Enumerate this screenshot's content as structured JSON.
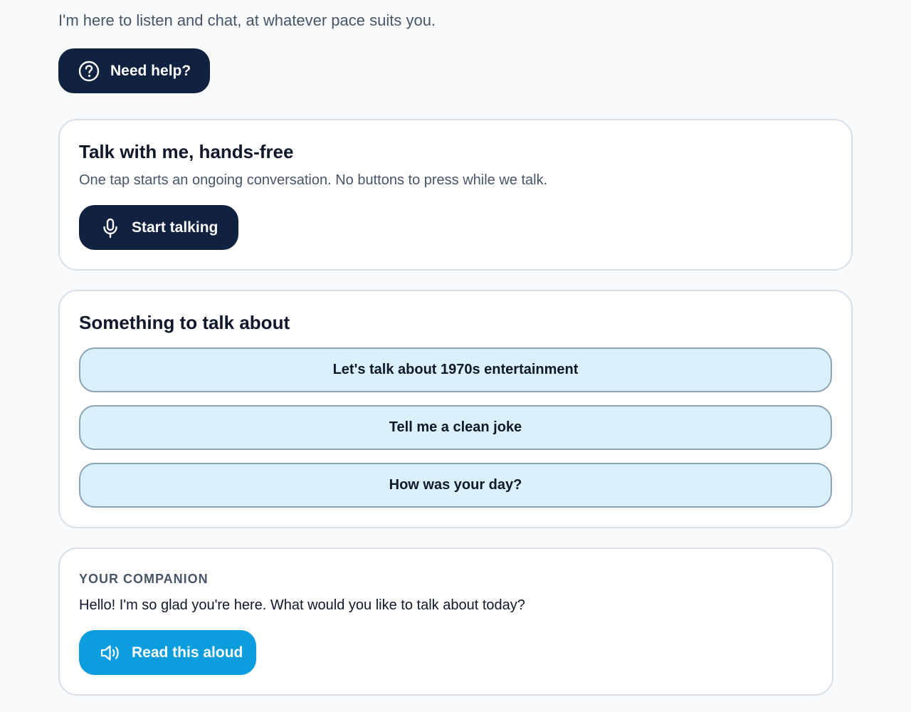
{
  "intro": {
    "text": "I'm here to listen and chat, at whatever pace suits you."
  },
  "help_button": {
    "label": "Need help?",
    "icon": "question-circle-icon"
  },
  "talk_card": {
    "title": "Talk with me, hands-free",
    "description": "One tap starts an ongoing conversation. No buttons to press while we talk.",
    "start_button": {
      "label": "Start talking",
      "icon": "microphone-icon"
    }
  },
  "topics_card": {
    "title": "Something to talk about",
    "topics": [
      {
        "label": "Let's talk about 1970s entertainment"
      },
      {
        "label": "Tell me a clean joke"
      },
      {
        "label": "How was your day?"
      }
    ]
  },
  "companion_card": {
    "label": "YOUR COMPANION",
    "message": "Hello! I'm so glad you're here. What would you like to talk about today?",
    "read_button": {
      "label": "Read this aloud",
      "icon": "speaker-icon"
    }
  },
  "colors": {
    "page_background": "#f8fafc",
    "dark_button": "#102240",
    "accent_blue": "#0b9ddd",
    "topic_background": "#daf0fd",
    "topic_border": "#8aa3b6",
    "card_border": "#d7dee6",
    "muted_text": "#475569"
  }
}
